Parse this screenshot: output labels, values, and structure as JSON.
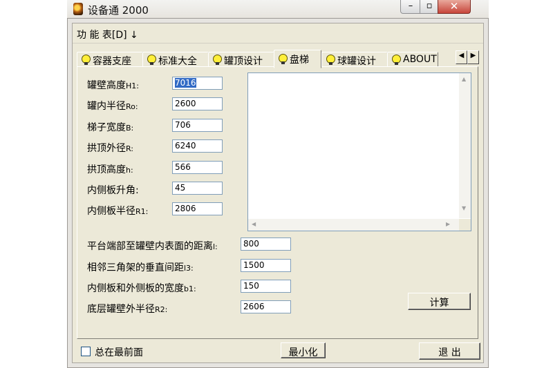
{
  "window": {
    "title": "设备通 2000"
  },
  "titlebar_buttons": {
    "minimize": "–",
    "maximize": "▫",
    "close": "✕"
  },
  "menu": {
    "label": "功 能 表[D] ↓"
  },
  "tabs": [
    {
      "label": "容器支座"
    },
    {
      "label": "标准大全"
    },
    {
      "label": "罐顶设计"
    },
    {
      "label": "盘梯",
      "active": true
    },
    {
      "label": "球罐设计"
    },
    {
      "label": "ABOUT"
    }
  ],
  "tab_scroll": {
    "left": "◀",
    "right": "▶"
  },
  "fields": [
    {
      "label": "罐壁高度",
      "sub": "H1:",
      "value": "7016",
      "selected": true
    },
    {
      "label": "罐内半径",
      "sub": "Ro:",
      "value": "2600"
    },
    {
      "label": "梯子宽度",
      "sub": "B:",
      "value": "706"
    },
    {
      "label": "拱顶外径",
      "sub": "R:",
      "value": "6240"
    },
    {
      "label": "拱顶高度",
      "sub": "h:",
      "value": "566"
    },
    {
      "label": "内侧板升角:",
      "sub": "",
      "value": "45"
    },
    {
      "label": "内侧板半径",
      "sub": "R1:",
      "value": "2806"
    }
  ],
  "lower_fields": [
    {
      "label": "平台端部至罐壁内表面的距离",
      "sub": "l:",
      "value": "800"
    },
    {
      "label": "相邻三角架的垂直间距",
      "sub": "l3:",
      "value": "1500"
    },
    {
      "label": "内侧板和外侧板的宽度",
      "sub": "b1:",
      "value": "150"
    },
    {
      "label": "底层罐壁外半径",
      "sub": "R2:",
      "value": "2606"
    }
  ],
  "buttons": {
    "calculate": "计算",
    "minimize": "最小化",
    "exit": "退  出"
  },
  "checkbox": {
    "label": "总在最前面",
    "checked": false
  },
  "scroll_arrows": {
    "up": "▲",
    "down": "▼",
    "left": "◀",
    "right": "▶"
  }
}
